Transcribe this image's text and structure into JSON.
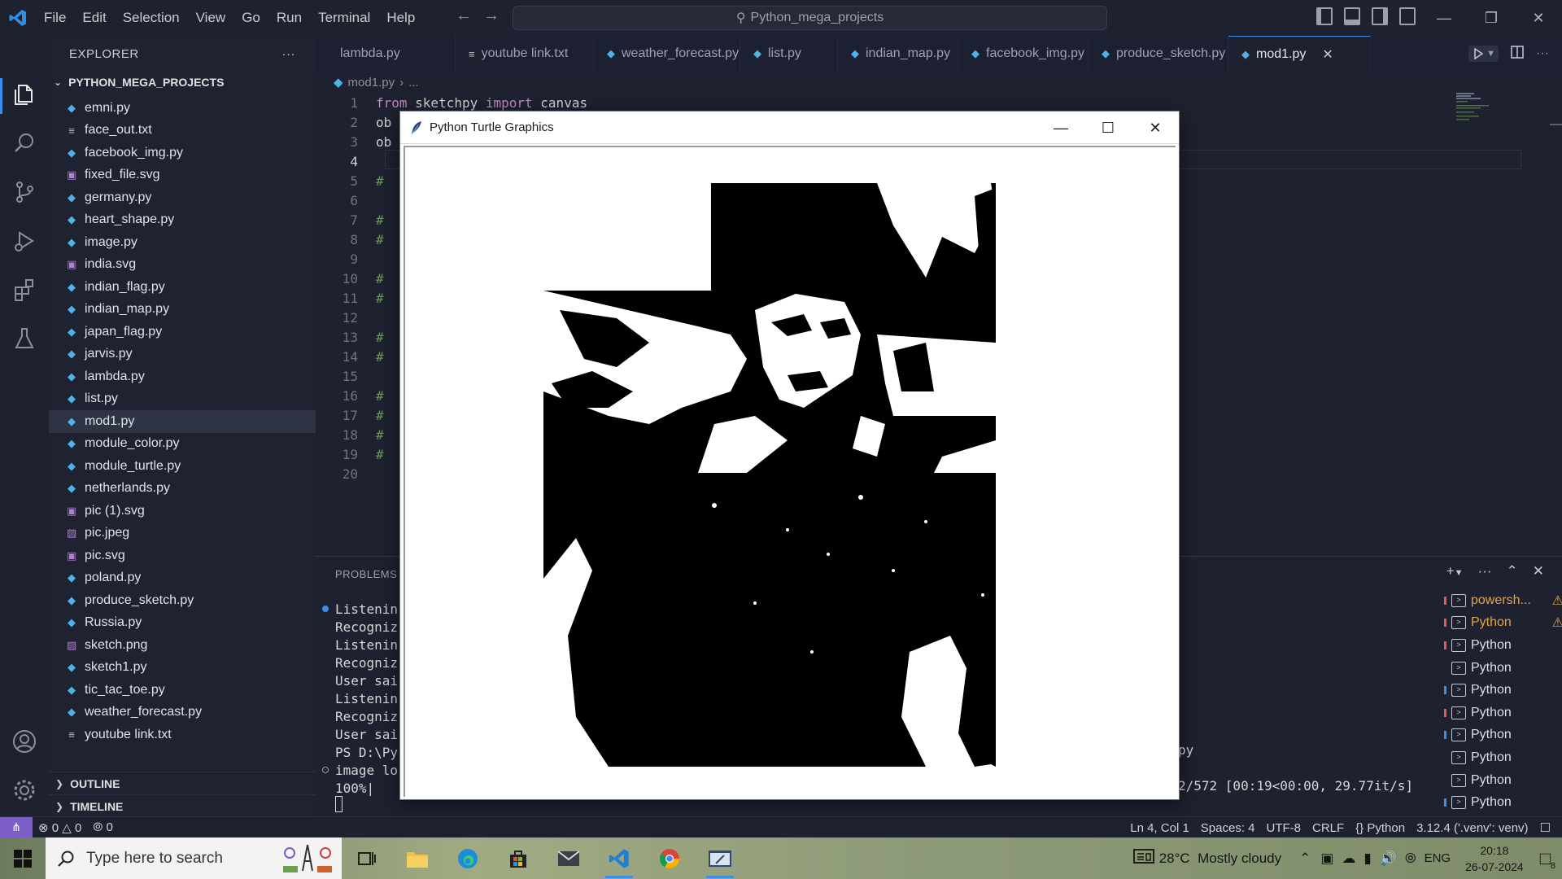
{
  "menu": [
    "File",
    "Edit",
    "Selection",
    "View",
    "Go",
    "Run",
    "Terminal",
    "Help"
  ],
  "command_center": "Python_mega_projects",
  "sidebar": {
    "title": "EXPLORER",
    "more": "···",
    "folder": "PYTHON_MEGA_PROJECTS",
    "files": [
      {
        "name": "emni.py",
        "type": "py"
      },
      {
        "name": "face_out.txt",
        "type": "txt"
      },
      {
        "name": "facebook_img.py",
        "type": "py"
      },
      {
        "name": "fixed_file.svg",
        "type": "svg"
      },
      {
        "name": "germany.py",
        "type": "py"
      },
      {
        "name": "heart_shape.py",
        "type": "py"
      },
      {
        "name": "image.py",
        "type": "py"
      },
      {
        "name": "india.svg",
        "type": "svg"
      },
      {
        "name": "indian_flag.py",
        "type": "py"
      },
      {
        "name": "indian_map.py",
        "type": "py"
      },
      {
        "name": "japan_flag.py",
        "type": "py"
      },
      {
        "name": "jarvis.py",
        "type": "py"
      },
      {
        "name": "lambda.py",
        "type": "py"
      },
      {
        "name": "list.py",
        "type": "py"
      },
      {
        "name": "mod1.py",
        "type": "py",
        "active": true
      },
      {
        "name": "module_color.py",
        "type": "py"
      },
      {
        "name": "module_turtle.py",
        "type": "py"
      },
      {
        "name": "netherlands.py",
        "type": "py"
      },
      {
        "name": "pic (1).svg",
        "type": "svg"
      },
      {
        "name": "pic.jpeg",
        "type": "img"
      },
      {
        "name": "pic.svg",
        "type": "svg"
      },
      {
        "name": "poland.py",
        "type": "py"
      },
      {
        "name": "produce_sketch.py",
        "type": "py"
      },
      {
        "name": "Russia.py",
        "type": "py"
      },
      {
        "name": "sketch.png",
        "type": "img"
      },
      {
        "name": "sketch1.py",
        "type": "py"
      },
      {
        "name": "tic_tac_toe.py",
        "type": "py"
      },
      {
        "name": "weather_forecast.py",
        "type": "py"
      },
      {
        "name": "youtube link.txt",
        "type": "txt"
      }
    ],
    "outline": "OUTLINE",
    "timeline": "TIMELINE"
  },
  "tabs": [
    {
      "label": "lambda.py",
      "type": "py"
    },
    {
      "label": "youtube link.txt",
      "type": "txt"
    },
    {
      "label": "weather_forecast.py",
      "type": "py"
    },
    {
      "label": "list.py",
      "type": "py"
    },
    {
      "label": "indian_map.py",
      "type": "py"
    },
    {
      "label": "facebook_img.py",
      "type": "py"
    },
    {
      "label": "produce_sketch.py",
      "type": "py"
    },
    {
      "label": "mod1.py",
      "type": "py",
      "active": true
    }
  ],
  "breadcrumb": {
    "file": "mod1.py",
    "rest": "..."
  },
  "editor": {
    "line_numbers": [
      "1",
      "2",
      "3",
      "4",
      "5",
      "6",
      "7",
      "8",
      "9",
      "10",
      "11",
      "12",
      "13",
      "14",
      "15",
      "16",
      "17",
      "18",
      "19",
      "20"
    ],
    "current_line": "4",
    "line1_kw1": "from",
    "line1_mod": " sketchpy ",
    "line1_kw2": "import",
    "line1_rest": " canvas",
    "line2": "ob",
    "line3": "ob",
    "comment": "#"
  },
  "panel": {
    "tab": "PROBLEMS",
    "terminal_lines": [
      "Listenin",
      "Recogniz",
      "Listenin",
      "Recogniz",
      "User sai",
      "Listenin",
      "Recogniz",
      "User sai",
      "PS D:\\Py",
      "image lo",
      "100%|"
    ],
    "tail_py": "py",
    "tail_progress": "2/572 [00:19<00:00, 29.77it/s]",
    "terminals": [
      {
        "label": "powersh...",
        "warn": true,
        "mark": "#e05a5a"
      },
      {
        "label": "Python",
        "warn": true,
        "mark": "#e05a5a"
      },
      {
        "label": "Python",
        "mark": "#e05a5a"
      },
      {
        "label": "Python",
        "mark": ""
      },
      {
        "label": "Python",
        "mark": "#3b8eea"
      },
      {
        "label": "Python",
        "mark": "#e05a5a"
      },
      {
        "label": "Python",
        "mark": "#3b8eea"
      },
      {
        "label": "Python",
        "mark": ""
      },
      {
        "label": "Python",
        "mark": ""
      },
      {
        "label": "Python",
        "mark": "#3b8eea"
      }
    ]
  },
  "statusbar": {
    "errors": "0",
    "warnings": "0",
    "ports": "0",
    "position": "Ln 4, Col 1",
    "spaces": "Spaces: 4",
    "encoding": "UTF-8",
    "eol": "CRLF",
    "language": "Python",
    "interpreter": "3.12.4 ('.venv': venv)"
  },
  "turtle": {
    "title": "Python Turtle Graphics"
  },
  "taskbar": {
    "search_placeholder": "Type here to search",
    "weather": "28°C  Mostly cloudy",
    "lang": "ENG",
    "time": "20:18",
    "date": "26-07-2024",
    "notifications": "8"
  },
  "colors": {
    "accent": "#3b8eea",
    "remote": "#7b5fc7",
    "keyword": "#c586c0",
    "comment": "#6a9955",
    "warning": "#e3a34b"
  }
}
